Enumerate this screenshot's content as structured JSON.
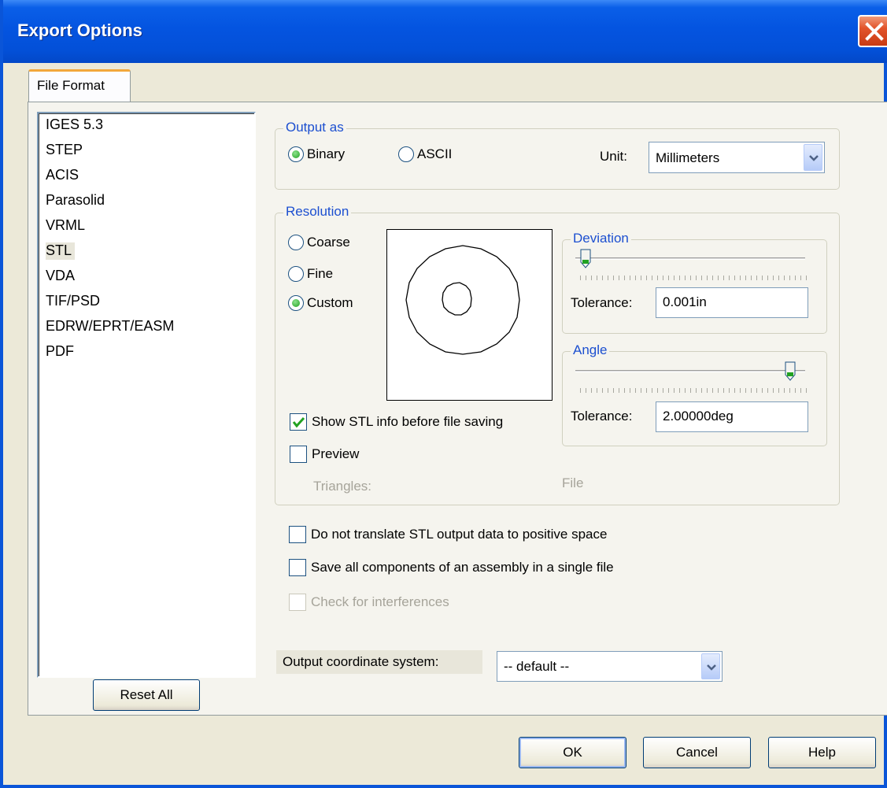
{
  "window": {
    "title": "Export Options",
    "close_label": "close"
  },
  "tabs": [
    {
      "label": "File Format"
    }
  ],
  "format_list": {
    "items": [
      "IGES 5.3",
      "STEP",
      "ACIS",
      "Parasolid",
      "VRML",
      "STL",
      "VDA",
      "TIF/PSD",
      "EDRW/EPRT/EASM",
      "PDF"
    ],
    "selected": "STL"
  },
  "reset_all_label": "Reset All",
  "output_as": {
    "legend": "Output as",
    "binary_label": "Binary",
    "ascii_label": "ASCII",
    "selected": "Binary",
    "unit_label": "Unit:",
    "unit_value": "Millimeters"
  },
  "resolution": {
    "legend": "Resolution",
    "coarse_label": "Coarse",
    "fine_label": "Fine",
    "custom_label": "Custom",
    "selected": "Custom",
    "show_stl_info_label": "Show STL info before file saving",
    "show_stl_info_checked": true,
    "preview_label": "Preview",
    "preview_checked": false,
    "triangles_label": "Triangles:",
    "file_label": "File",
    "deviation": {
      "legend": "Deviation",
      "tolerance_label": "Tolerance:",
      "tolerance_value": "0.001in",
      "slider_position": 0.04
    },
    "angle": {
      "legend": "Angle",
      "tolerance_label": "Tolerance:",
      "tolerance_value": "2.00000deg",
      "slider_position": 0.94
    }
  },
  "options": {
    "no_translate_label": "Do not translate STL output data to positive space",
    "no_translate_checked": false,
    "save_all_label": "Save all components of an assembly in a single file",
    "save_all_checked": false,
    "check_interferences_label": "Check for interferences",
    "check_interferences_checked": false,
    "check_interferences_enabled": false
  },
  "coordinate_system": {
    "label": "Output coordinate system:",
    "value": "-- default --"
  },
  "buttons": {
    "ok": "OK",
    "cancel": "Cancel",
    "help": "Help"
  },
  "colors": {
    "titlebar": "#0454e0",
    "legend_text": "#1c4fd0",
    "dialog_bg": "#ece9d8"
  }
}
